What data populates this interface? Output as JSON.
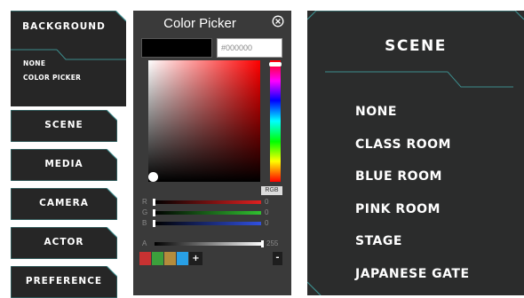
{
  "menu": {
    "background": {
      "label": "BACKGROUND",
      "options": [
        "NONE",
        "COLOR PICKER"
      ]
    },
    "items": [
      {
        "label": "SCENE"
      },
      {
        "label": "MEDIA"
      },
      {
        "label": "CAMERA"
      },
      {
        "label": "ACTOR"
      },
      {
        "label": "PREFERENCE"
      }
    ]
  },
  "color_picker": {
    "title": "Color Picker",
    "close_icon": "close-circle-icon",
    "hex_value": "#000000",
    "mode_label": "RGB",
    "channels": [
      {
        "label": "R",
        "value": "0",
        "color": "#e02020"
      },
      {
        "label": "G",
        "value": "0",
        "color": "#30c030"
      },
      {
        "label": "B",
        "value": "0",
        "color": "#3050e0"
      }
    ],
    "alpha": {
      "label": "A",
      "value": "255"
    },
    "palette": {
      "colors": [
        "#c83232",
        "#3ca03c",
        "#b48c3c",
        "#28a0e6"
      ],
      "add_label": "+",
      "remove_label": "-"
    }
  },
  "scene_panel": {
    "title": "SCENE",
    "items": [
      "NONE",
      "CLASS ROOM",
      "BLUE ROOM",
      "PINK ROOM",
      "STAGE",
      "JAPANESE GATE"
    ]
  },
  "colors": {
    "panel_bg": "#2b2c2c",
    "accent_line": "#3c8c8c",
    "button_bg": "#262626"
  }
}
